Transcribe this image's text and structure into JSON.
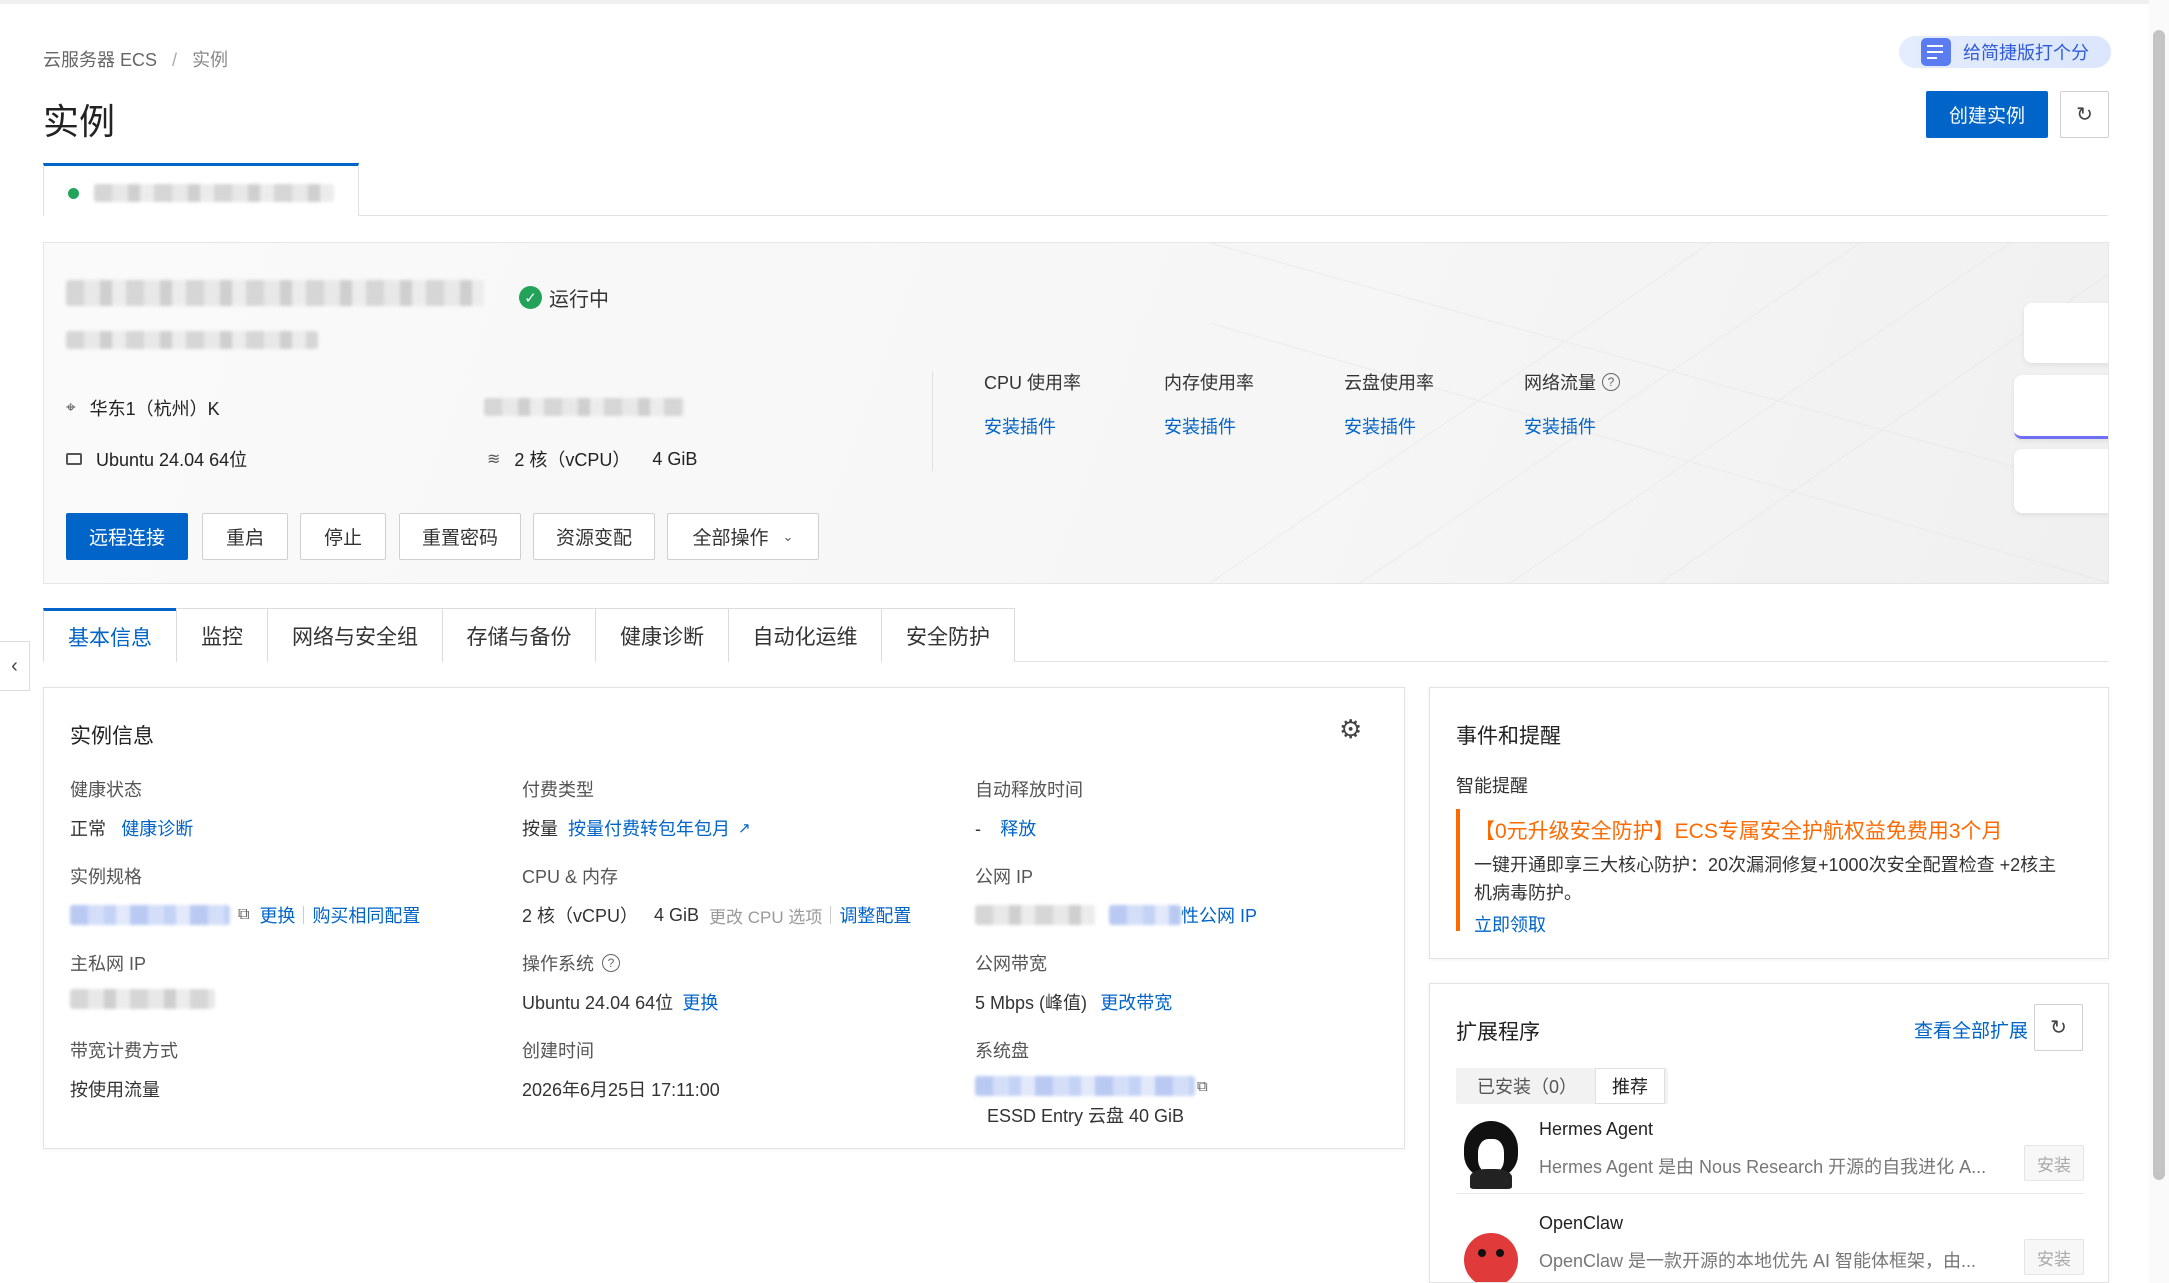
{
  "breadcrumb": {
    "root": "云服务器 ECS",
    "sep": "/",
    "current": "实例"
  },
  "page_title": "实例",
  "feedback": {
    "label": "给简捷版打个分"
  },
  "header_buttons": {
    "create": "创建实例"
  },
  "instance": {
    "status": "运行中",
    "region": "华东1（杭州）K",
    "os": "Ubuntu 24.04 64位",
    "cpu": "2 核（vCPU）",
    "memory": "4 GiB"
  },
  "metrics": [
    {
      "title": "CPU 使用率",
      "link": "安装插件"
    },
    {
      "title": "内存使用率",
      "link": "安装插件"
    },
    {
      "title": "云盘使用率",
      "link": "安装插件"
    },
    {
      "title": "网络流量",
      "link": "安装插件"
    }
  ],
  "actions": {
    "connect": "远程连接",
    "restart": "重启",
    "stop": "停止",
    "reset_pwd": "重置密码",
    "resize": "资源变配",
    "all": "全部操作"
  },
  "tabs": [
    "基本信息",
    "监控",
    "网络与安全组",
    "存储与备份",
    "健康诊断",
    "自动化运维",
    "安全防护"
  ],
  "info": {
    "title": "实例信息",
    "health_label": "健康状态",
    "health_value": "正常",
    "health_link": "健康诊断",
    "billing_label": "付费类型",
    "billing_value": "按量",
    "billing_link": "按量付费转包年包月",
    "release_label": "自动释放时间",
    "release_value": "-",
    "release_link": "释放",
    "spec_label": "实例规格",
    "spec_change": "更换",
    "spec_buy": "购买相同配置",
    "cpumem_label": "CPU & 内存",
    "cpumem_cpu": "2 核（vCPU）",
    "cpumem_mem": "4 GiB",
    "cpumem_hint": "更改 CPU 选项",
    "cpumem_link": "调整配置",
    "pubip_label": "公网 IP",
    "pubip_link": "性公网 IP",
    "privip_label": "主私网 IP",
    "os_label": "操作系统",
    "os_value": "Ubuntu 24.04 64位",
    "os_link": "更换",
    "bw_label": "公网带宽",
    "bw_value": "5 Mbps (峰值)",
    "bw_link": "更改带宽",
    "bwbill_label": "带宽计费方式",
    "bwbill_value": "按使用流量",
    "created_label": "创建时间",
    "created_value": "2026年6月25日 17:11:00",
    "disk_label": "系统盘",
    "disk_value": "ESSD Entry 云盘  40 GiB"
  },
  "events": {
    "title": "事件和提醒",
    "sub": "智能提醒",
    "promo_title": "【0元升级安全防护】ECS专属安全护航权益免费用3个月",
    "promo_body": "一键开通即享三大核心防护：20次漏洞修复+1000次安全配置检查 +2核主机病毒防护。",
    "promo_link": "立即领取"
  },
  "extensions": {
    "title": "扩展程序",
    "view_all": "查看全部扩展",
    "tab_installed": "已安装（0）",
    "tab_recommend": "推荐",
    "items": [
      {
        "name": "Hermes Agent",
        "desc": "Hermes Agent 是由 Nous Research 开源的自我进化 A...",
        "action": "安装"
      },
      {
        "name": "OpenClaw",
        "desc": "OpenClaw 是一款开源的本地优先 AI 智能体框架，由...",
        "action": "安装"
      }
    ]
  },
  "colors": {
    "primary": "#0064c8",
    "success": "#23a35a",
    "warning": "#ff6a00"
  }
}
